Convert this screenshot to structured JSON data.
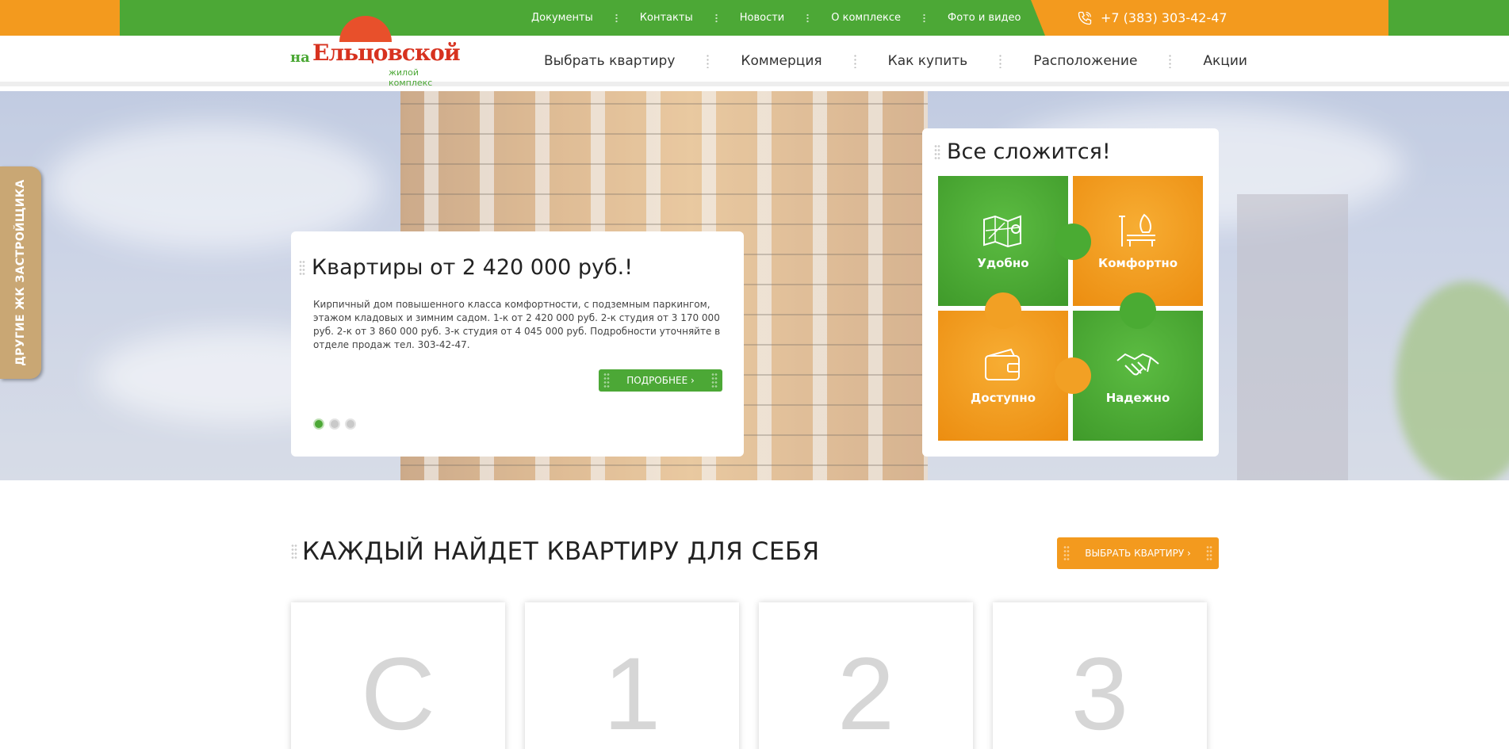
{
  "topbar": {
    "links": [
      "Документы",
      "Контакты",
      "Новости",
      "О комплексе",
      "Фото и видео"
    ],
    "phone": "+7 (383) 303-42-47"
  },
  "logo": {
    "prefix": "на",
    "name": "Ельцовской",
    "subtitle": "жилой комплекс"
  },
  "nav": {
    "items": [
      "Выбрать квартиру",
      "Коммерция",
      "Как купить",
      "Расположение",
      "Акции"
    ]
  },
  "side_tab": {
    "label": "ДРУГИЕ ЖК ЗАСТРОЙЩИКА"
  },
  "slide": {
    "title": "Квартиры от 2 420 000 руб.!",
    "text": "Кирпичный дом повышенного класса комфортности, с подземным паркингом, этажом кладовых и зимним садом. 1-к от 2 420 000 руб. 2-к студия от 3 170 000 руб. 2-к от 3 860 000 руб. 3-к студия от 4 045 000 руб. Подробности уточняйте в отделе продаж тел. 303-42-47.",
    "button": "ПОДРОБНЕЕ ›",
    "dots_total": 3,
    "dots_active": 1
  },
  "puzzle": {
    "title": "Все сложится!",
    "tiles": [
      {
        "label": "Удобно",
        "icon": "map-icon",
        "color": "#4ca836"
      },
      {
        "label": "Комфортно",
        "icon": "park-bench-icon",
        "color": "#f39a1e"
      },
      {
        "label": "Доступно",
        "icon": "wallet-icon",
        "color": "#f39a1e"
      },
      {
        "label": "Надежно",
        "icon": "handshake-icon",
        "color": "#4ca836"
      }
    ]
  },
  "section": {
    "title": "КАЖДЫЙ НАЙДЕТ КВАРТИРУ ДЛЯ СЕБЯ",
    "button": "ВЫБРАТЬ КВАРТИРУ ›",
    "cards": [
      "С",
      "1",
      "2",
      "3"
    ]
  },
  "colors": {
    "green": "#4ca836",
    "orange": "#f39a1e",
    "logo_red": "#d7321f"
  }
}
